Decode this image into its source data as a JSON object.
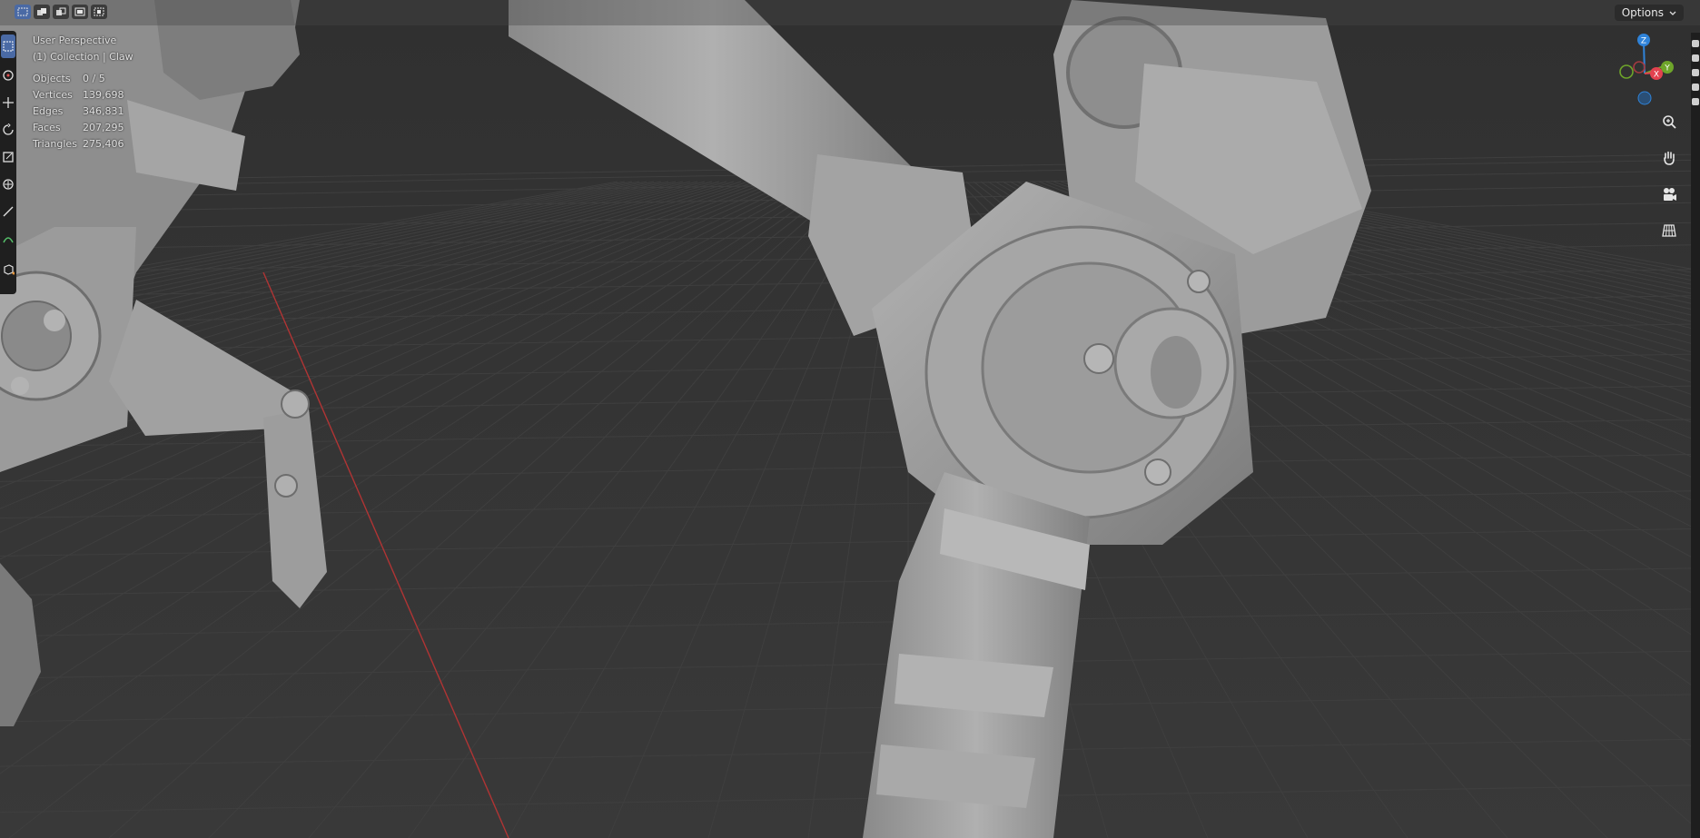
{
  "viewport": {
    "perspective_label": "User Perspective",
    "collection_label": "(1) Collection | Claw",
    "stats": [
      {
        "label": "Objects",
        "value": "0 / 5"
      },
      {
        "label": "Vertices",
        "value": "139,698"
      },
      {
        "label": "Edges",
        "value": "346,831"
      },
      {
        "label": "Faces",
        "value": "207,295"
      },
      {
        "label": "Triangles",
        "value": "275,406"
      }
    ]
  },
  "header": {
    "options_label": "Options",
    "select_modes": [
      "select-new-icon",
      "select-extend-icon",
      "select-subtract-icon",
      "select-invert-icon",
      "select-intersect-icon"
    ]
  },
  "toolbar": {
    "tools": [
      "select-box-icon",
      "cursor-icon",
      "move-icon",
      "rotate-icon",
      "scale-icon",
      "transform-icon",
      "annotate-icon",
      "measure-icon",
      "add-cube-icon"
    ]
  },
  "gizmo": {
    "z_label": "Z",
    "y_label": "Y",
    "x_label": "X",
    "colors": {
      "x": "#e2424f",
      "y": "#6ea52a",
      "z": "#2f83d9"
    }
  },
  "navigation": [
    "zoom-icon",
    "pan-hand-icon",
    "camera-view-icon",
    "ortho-grid-icon"
  ],
  "colors": {
    "background": "#333333",
    "grid_line": "#3c3c3c",
    "x_axis_line": "#b03434",
    "model": "#9a9a9a",
    "accent": "#4a6aa5"
  }
}
